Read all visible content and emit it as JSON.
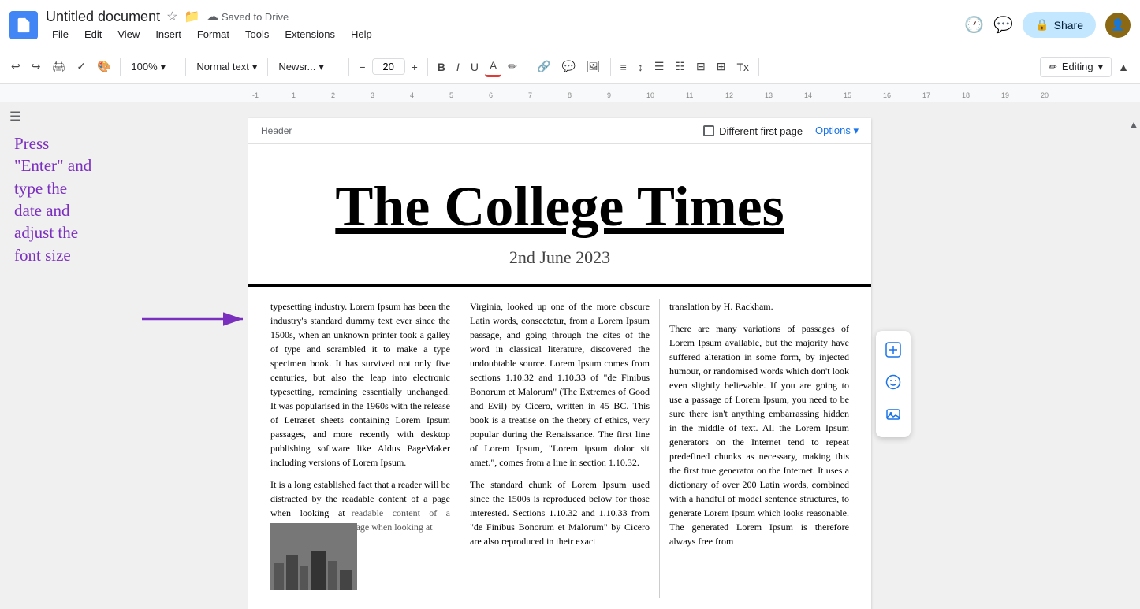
{
  "app": {
    "icon_color": "#4285f4",
    "doc_title": "Untitled document",
    "saved_status": "Saved to Drive",
    "menu_items": [
      "File",
      "Edit",
      "View",
      "Insert",
      "Format",
      "Tools",
      "Extensions",
      "Help"
    ],
    "share_label": "Share",
    "editing_mode_label": "Editing"
  },
  "toolbar": {
    "undo_label": "↩",
    "redo_label": "↪",
    "print_label": "🖨",
    "spellcheck_label": "✓",
    "paint_label": "🎨",
    "zoom_value": "100%",
    "style_label": "Normal text",
    "font_label": "Newsr...",
    "font_size": "20",
    "bold_label": "B",
    "italic_label": "I",
    "underline_label": "U",
    "text_color_label": "A",
    "highlight_label": "✏",
    "link_label": "🔗",
    "comment_label": "💬",
    "image_label": "🖼",
    "align_label": "≡",
    "spacing_label": "↕",
    "bullets_label": "☰",
    "indent_label": "⊞",
    "dec_indent_label": "⊟",
    "clear_format_label": "Tx"
  },
  "document": {
    "header_label": "Header",
    "diff_first_page_label": "Different first page",
    "options_label": "Options",
    "newspaper_title": "The College Times",
    "newspaper_date": "2nd June 2023",
    "col1_text1": "typesetting industry. Lorem Ipsum has been the industry's standard dummy text ever since the 1500s, when an unknown printer took a galley of type and scrambled it to make a type specimen book. It has survived not only five centuries, but also the leap into electronic typesetting, remaining essentially unchanged. It was popularised in the 1960s with the release of Letraset sheets containing Lorem Ipsum passages, and more recently with desktop publishing software like Aldus PageMaker including versions of Lorem Ipsum.",
    "col1_text2": "It is a long established fact that a reader will be distracted by the readable content of a page when looking at",
    "col2_text1": "Virginia, looked up one of the more obscure Latin words, consectetur, from a Lorem Ipsum passage, and going through the cites of the word in classical literature, discovered the undoubtable source. Lorem Ipsum comes from sections 1.10.32 and 1.10.33 of \"de Finibus Bonorum et Malorum\" (The Extremes of Good and Evil) by Cicero, written in 45 BC. This book is a treatise on the theory of ethics, very popular during the Renaissance. The first line of Lorem Ipsum, \"Lorem ipsum dolor sit amet.\", comes from a line in section 1.10.32.",
    "col2_text2": "The standard chunk of Lorem Ipsum used since the 1500s is reproduced below for those interested. Sections 1.10.32 and 1.10.33 from \"de Finibus Bonorum et Malorum\" by Cicero are also reproduced in their exact",
    "col3_text1": "translation by H. Rackham.",
    "col3_text2": "There are many variations of passages of Lorem Ipsum available, but the majority have suffered alteration in some form, by injected humour, or randomised words which don't look even slightly believable. If you are going to use a passage of Lorem Ipsum, you need to be sure there isn't anything embarrassing hidden in the middle of text. All the Lorem Ipsum generators on the Internet tend to repeat predefined chunks as necessary, making this the first true generator on the Internet. It uses a dictionary of over 200 Latin words, combined with a handful of model sentence structures, to generate Lorem Ipsum which looks reasonable. The generated Lorem Ipsum is therefore always free from"
  },
  "annotation": {
    "text": "Press\n\"Enter\" and\ntype the\ndate and\nadjust the\nfont size",
    "color": "#7b2fbe"
  },
  "side_tools": {
    "add_label": "+",
    "emoji_label": "☺",
    "image_label": "🖼"
  }
}
